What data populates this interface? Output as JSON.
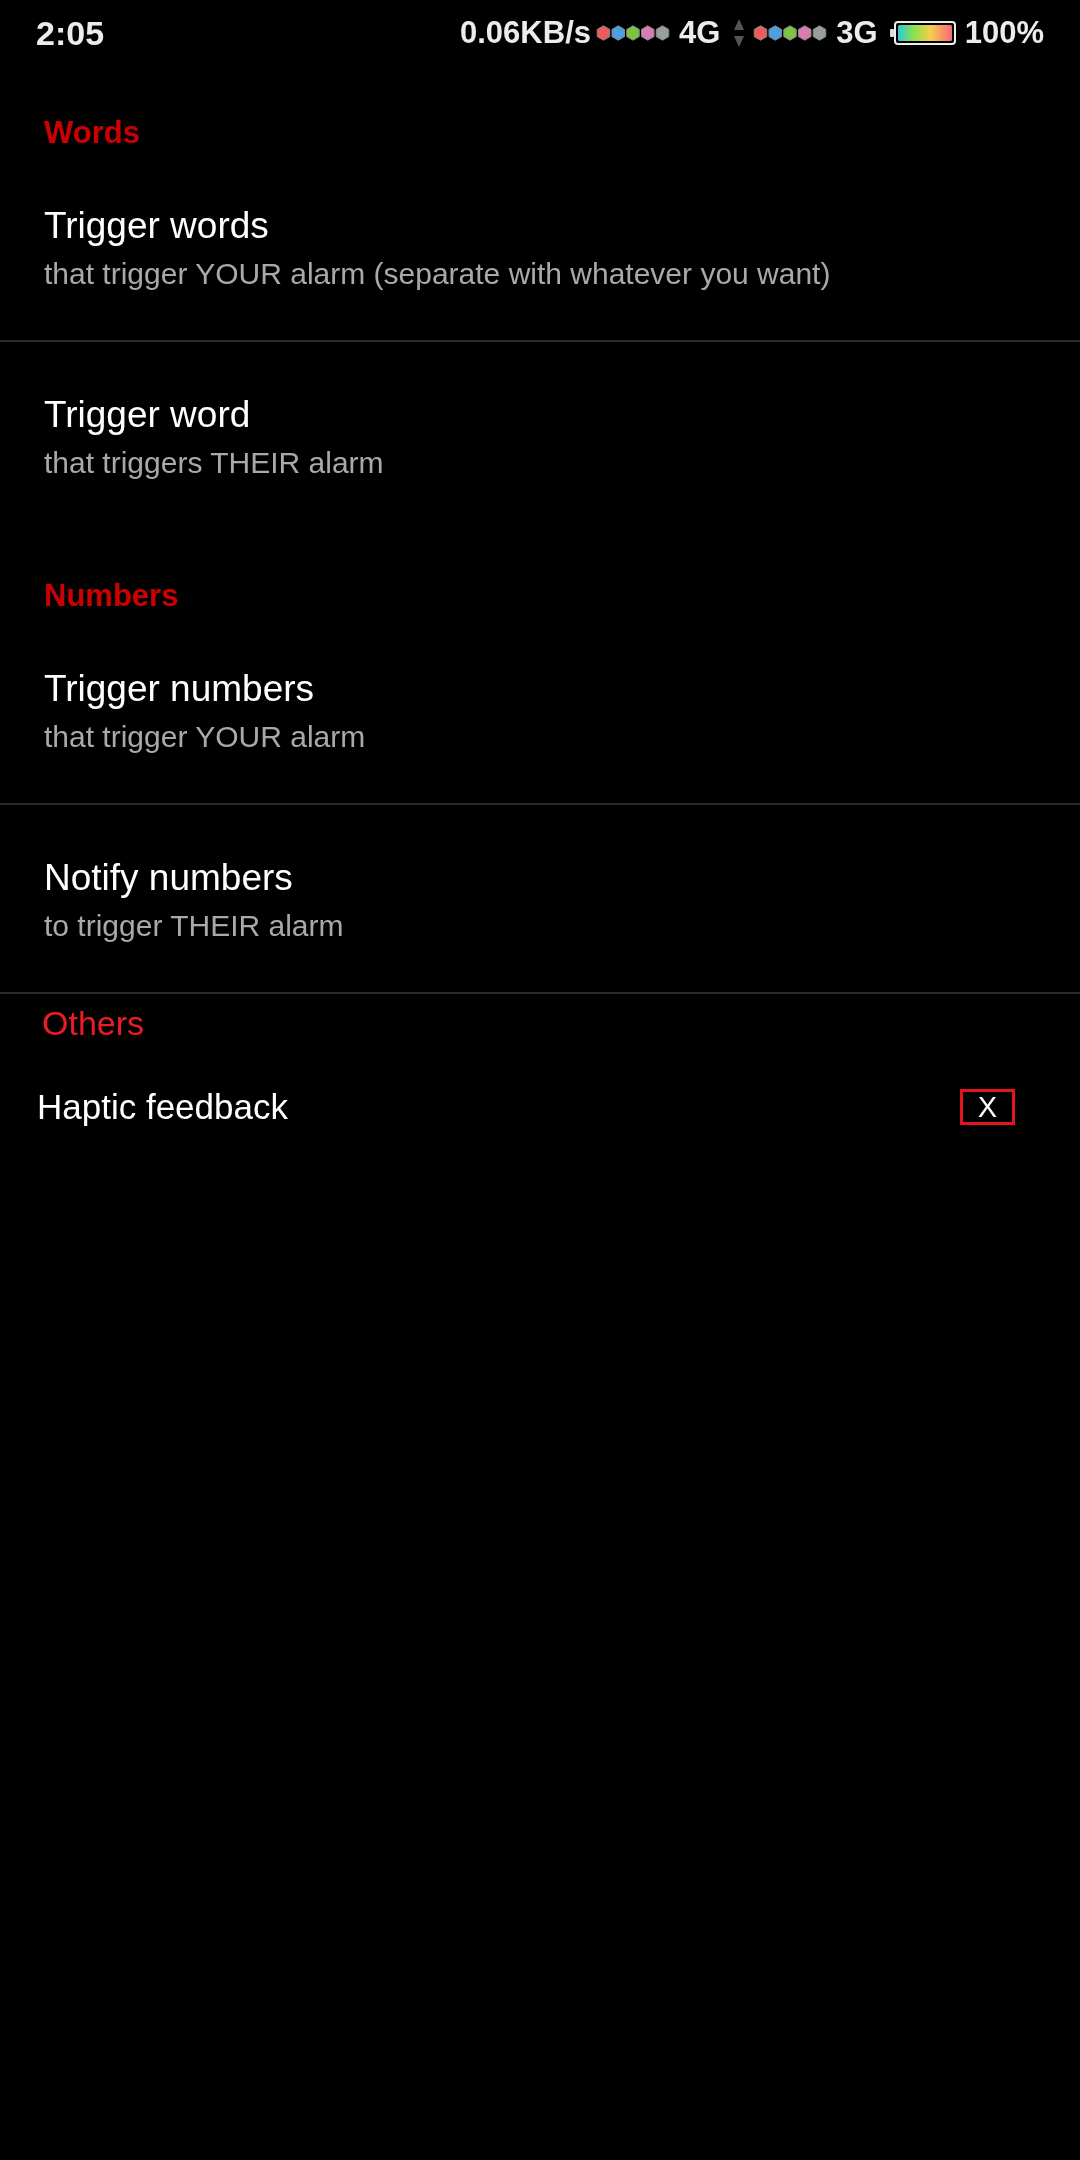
{
  "status_bar": {
    "time": "2:05",
    "network_speed": "0.06KB/s",
    "sims": [
      {
        "network_type": "4G"
      },
      {
        "network_type": "3G"
      }
    ],
    "battery_percent": "100%"
  },
  "sections": [
    {
      "kind": "preference",
      "title": "Words",
      "items": [
        {
          "title": "Trigger words",
          "summary": "that trigger YOUR alarm (separate with whatever you want)"
        },
        {
          "title": "Trigger word",
          "summary": "that triggers THEIR alarm"
        }
      ]
    },
    {
      "kind": "preference",
      "title": "Numbers",
      "items": [
        {
          "title": "Trigger numbers",
          "summary": "that trigger YOUR alarm"
        },
        {
          "title": "Notify numbers",
          "summary": "to trigger THEIR alarm"
        }
      ]
    },
    {
      "kind": "custom",
      "title": "Others",
      "items": [
        {
          "label": "Haptic feedback",
          "toggle": "X",
          "checked": true
        }
      ]
    }
  ]
}
